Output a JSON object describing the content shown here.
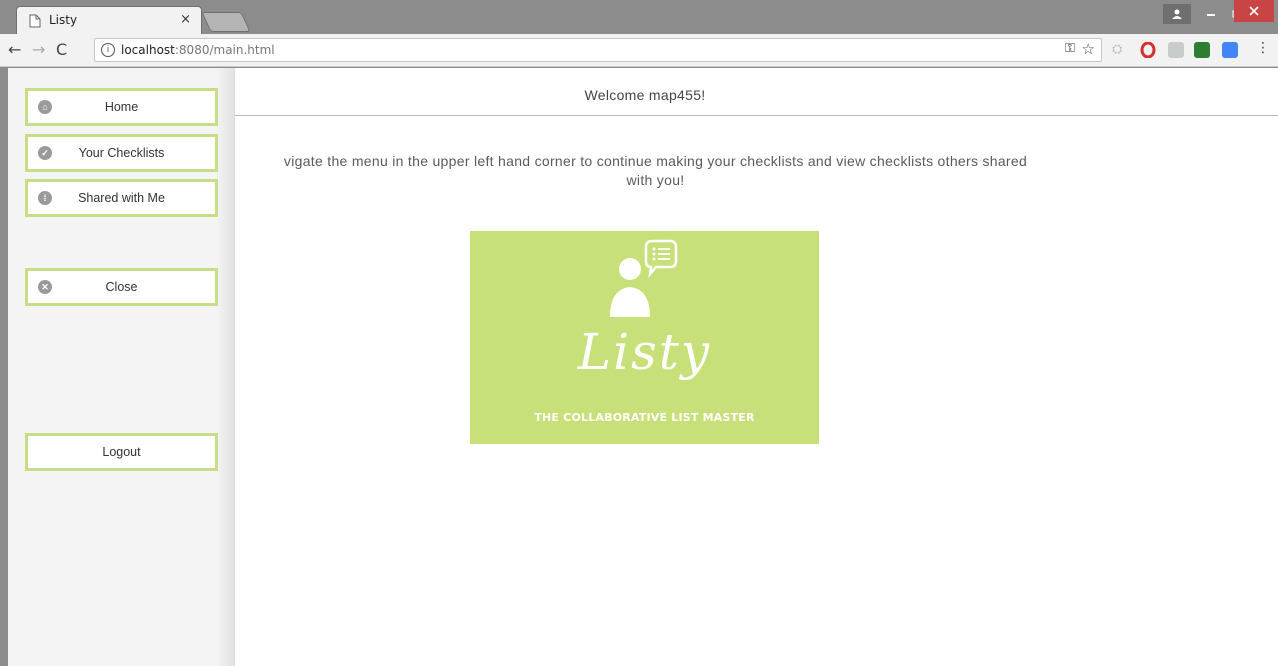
{
  "browser": {
    "tab_title": "Listy",
    "tab_close": "×",
    "url_host": "localhost",
    "url_path": ":8080/main.html",
    "extension_colors": [
      "#b8c4a0",
      "#d32f2f",
      "#9aa",
      "#2e7d32",
      "#4285f4"
    ]
  },
  "sidebar": {
    "items": [
      {
        "label": "Home",
        "icon": "home-icon"
      },
      {
        "label": "Your Checklists",
        "icon": "check-circle-icon"
      },
      {
        "label": "Shared with Me",
        "icon": "grid-circle-icon"
      },
      {
        "label": "Close",
        "icon": "close-circle-icon"
      },
      {
        "label": "Logout",
        "icon": ""
      }
    ]
  },
  "main": {
    "welcome": "Welcome map455!",
    "instructions_line1": "vigate the menu in the upper left hand corner to continue making your checklists and view checklists others shared",
    "instructions_line2": "with you!",
    "logo": {
      "name": "Listy",
      "tagline": "THE COLLABORATIVE LIST MASTER",
      "bg_color": "#c8e07a"
    }
  },
  "colors": {
    "menu_border": "#c6de86",
    "tab_bg": "#f2f2f2",
    "chrome_frame": "#8c8c8c"
  }
}
